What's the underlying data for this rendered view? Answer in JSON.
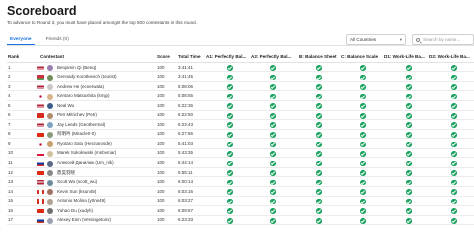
{
  "header": {
    "title": "Scoreboard",
    "subtitle": "To advance to Round 3, you must have placed amongst the top 500 contestants in this round."
  },
  "tabs": [
    {
      "label": "Everyone",
      "active": true
    },
    {
      "label": "Friends (0)",
      "active": false
    }
  ],
  "filters": {
    "country_select": "All Countries",
    "search_placeholder": "Search by name..."
  },
  "columns": [
    "Rank",
    "Contestant",
    "Score",
    "Total Time",
    "A1: Perfectly Bal...",
    "A2: Perfectly Bal...",
    "B: Balance Sheet",
    "C: Balance Scale",
    "D1: Work-Life Ba...",
    "D2: Work-Life Ba..."
  ],
  "colors": {
    "accent": "#1a73e8",
    "check": "#1aa260"
  },
  "rows": [
    {
      "rank": "1",
      "name": "Benjamin Qi (Benq)",
      "score": "100",
      "time": "3:41:41",
      "flag": "us",
      "avatar": "#9a7fb0"
    },
    {
      "rank": "2",
      "name": "Gennady Korotkevich (tourist)",
      "score": "100",
      "time": "3:41:45",
      "flag": "by",
      "avatar": "#6f8e5a"
    },
    {
      "rank": "3",
      "name": "Andrew He (ecnerwala)",
      "score": "100",
      "time": "5:08:06",
      "flag": "us",
      "avatar": "#c9c9c9"
    },
    {
      "rank": "4",
      "name": "Kentaro Matsushita (kmjp)",
      "score": "100",
      "time": "5:08:55",
      "flag": "jp",
      "avatar": "#d8b48a"
    },
    {
      "rank": "5",
      "name": "Neal Wu",
      "score": "100",
      "time": "5:22:36",
      "flag": "us",
      "avatar": "#3d5e8c"
    },
    {
      "rank": "6",
      "name": "Petr Mitrichev (Petr)",
      "score": "100",
      "time": "5:22:50",
      "flag": "ch",
      "avatar": "#b08a6a"
    },
    {
      "rank": "7",
      "name": "Jay Leeds (Geothermal)",
      "score": "100",
      "time": "5:23:43",
      "flag": "us",
      "avatar": "#7fa3c0"
    },
    {
      "rank": "8",
      "name": "阿明吟 (Miracle0-0)",
      "score": "100",
      "time": "5:27:56",
      "flag": "cn",
      "avatar": "#8a9a7a"
    },
    {
      "rank": "9",
      "name": "Ryotaro Sato (Hecnarosde)",
      "score": "100",
      "time": "5:41:03",
      "flag": "jp",
      "avatar": "#c8a070"
    },
    {
      "rank": "10",
      "name": "Marek Sokołowski (mnbvmar)",
      "score": "100",
      "time": "5:43:35",
      "flag": "pl",
      "avatar": "#d0c0a0"
    },
    {
      "rank": "11",
      "name": "Алексей Данилюк (Um_nik)",
      "score": "100",
      "time": "5:44:14",
      "flag": "ru",
      "avatar": "#5a6a8a"
    },
    {
      "rank": "12",
      "name": "鼎昊羽晓",
      "score": "100",
      "time": "5:55:11",
      "flag": "cn",
      "avatar": "#888888"
    },
    {
      "rank": "13",
      "name": "Scott Wu (scott_wu)",
      "score": "100",
      "time": "6:00:14",
      "flag": "us",
      "avatar": "#6a8aa0"
    },
    {
      "rank": "14",
      "name": "Kevin Sun (ksun48)",
      "score": "100",
      "time": "6:03:16",
      "flag": "ca",
      "avatar": "#a07060"
    },
    {
      "rank": "15",
      "name": "Antonio Molina (y0rw49)",
      "score": "100",
      "time": "6:03:27",
      "flag": "ca",
      "avatar": "#b0a090"
    },
    {
      "rank": "16",
      "name": "Yuhao Du (xudyh)",
      "score": "100",
      "time": "6:09:57",
      "flag": "cn",
      "avatar": "#707070"
    },
    {
      "rank": "17",
      "name": "Alexey Enin (Versingetorix)",
      "score": "100",
      "time": "6:23:33",
      "flag": "ru",
      "avatar": "#9aa0b0"
    }
  ]
}
